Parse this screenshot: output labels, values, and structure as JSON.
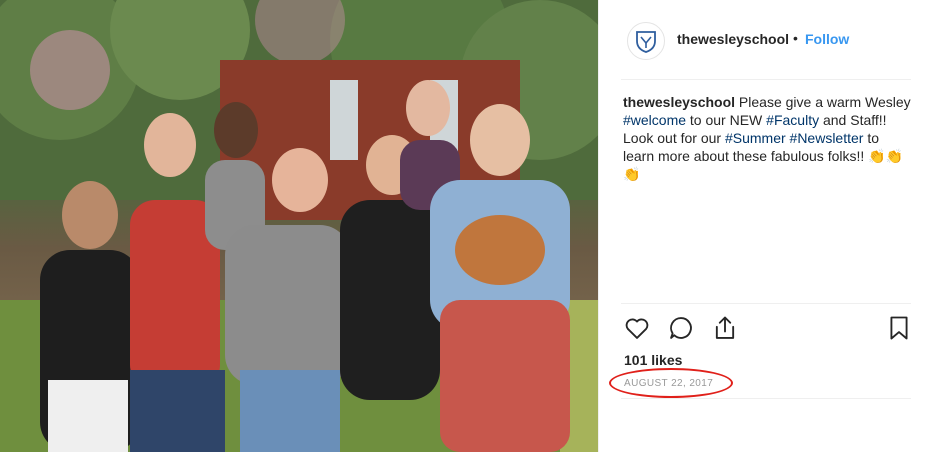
{
  "post": {
    "photo_icon": "group-photo",
    "handle": "thewesleyschool",
    "separator": "•",
    "follow_label": "Follow",
    "caption": {
      "user": "thewesleyschool",
      "t1": " Please give a warm Wesley ",
      "tag1": "#welcome",
      "t2": " to our NEW ",
      "tag2": "#Faculty",
      "t3": " and Staff!! Look out for our ",
      "tag3": "#Summer",
      "t4": " ",
      "tag4": "#Newsletter",
      "t5": " to learn more about these fabulous folks!! ",
      "emoji": "👏👏👏"
    },
    "likes": "101 likes",
    "date": "AUGUST 22, 2017"
  },
  "icons": {
    "like": "heart-icon",
    "comment": "comment-icon",
    "share": "share-icon",
    "save": "bookmark-icon",
    "avatar": "school-crest-icon"
  },
  "colors": {
    "accent": "#3897f0",
    "hashtag": "#003569",
    "annotation": "#e0201a"
  }
}
